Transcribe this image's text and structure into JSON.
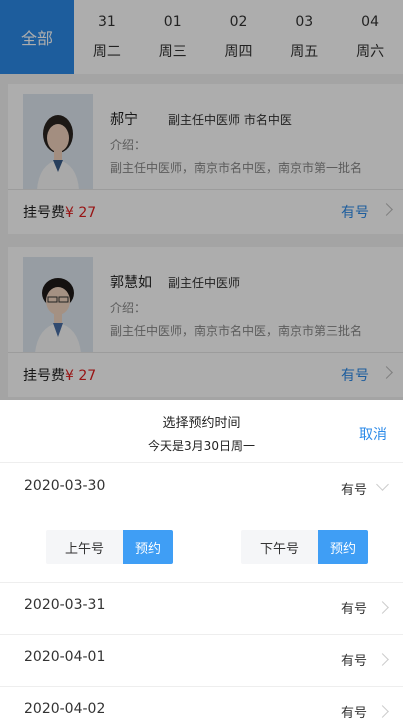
{
  "date_tabs": {
    "all_label": "全部",
    "days": [
      {
        "num": "31",
        "week": "周二"
      },
      {
        "num": "01",
        "week": "周三"
      },
      {
        "num": "02",
        "week": "周四"
      },
      {
        "num": "03",
        "week": "周五"
      },
      {
        "num": "04",
        "week": "周六"
      }
    ]
  },
  "doctors": [
    {
      "name": "郝宁",
      "title": "副主任中医师 市名中医",
      "intro_label": "介绍：",
      "intro": "副主任中医师，南京市名中医，南京市第一批名",
      "fee_label": "挂号费",
      "fee": "¥ 27",
      "availability": "有号"
    },
    {
      "name": "郭慧如",
      "title": "副主任中医师",
      "intro_label": "介绍：",
      "intro": "副主任中医师，南京市名中医，南京市第三批名",
      "fee_label": "挂号费",
      "fee": "¥ 27",
      "availability": "有号"
    }
  ],
  "sheet": {
    "title": "选择预约时间",
    "subtitle": "今天是3月30日周一",
    "cancel": "取消",
    "dates": [
      {
        "date": "2020-03-30",
        "status": "有号",
        "expanded": true
      },
      {
        "date": "2020-03-31",
        "status": "有号"
      },
      {
        "date": "2020-04-01",
        "status": "有号"
      },
      {
        "date": "2020-04-02",
        "status": "有号"
      }
    ],
    "slots": {
      "morning_label": "上午号",
      "afternoon_label": "下午号",
      "book_label": "预约"
    }
  },
  "colors": {
    "accent": "#2b8ae8",
    "book_button": "#3f9ef5",
    "price": "#e02020"
  }
}
